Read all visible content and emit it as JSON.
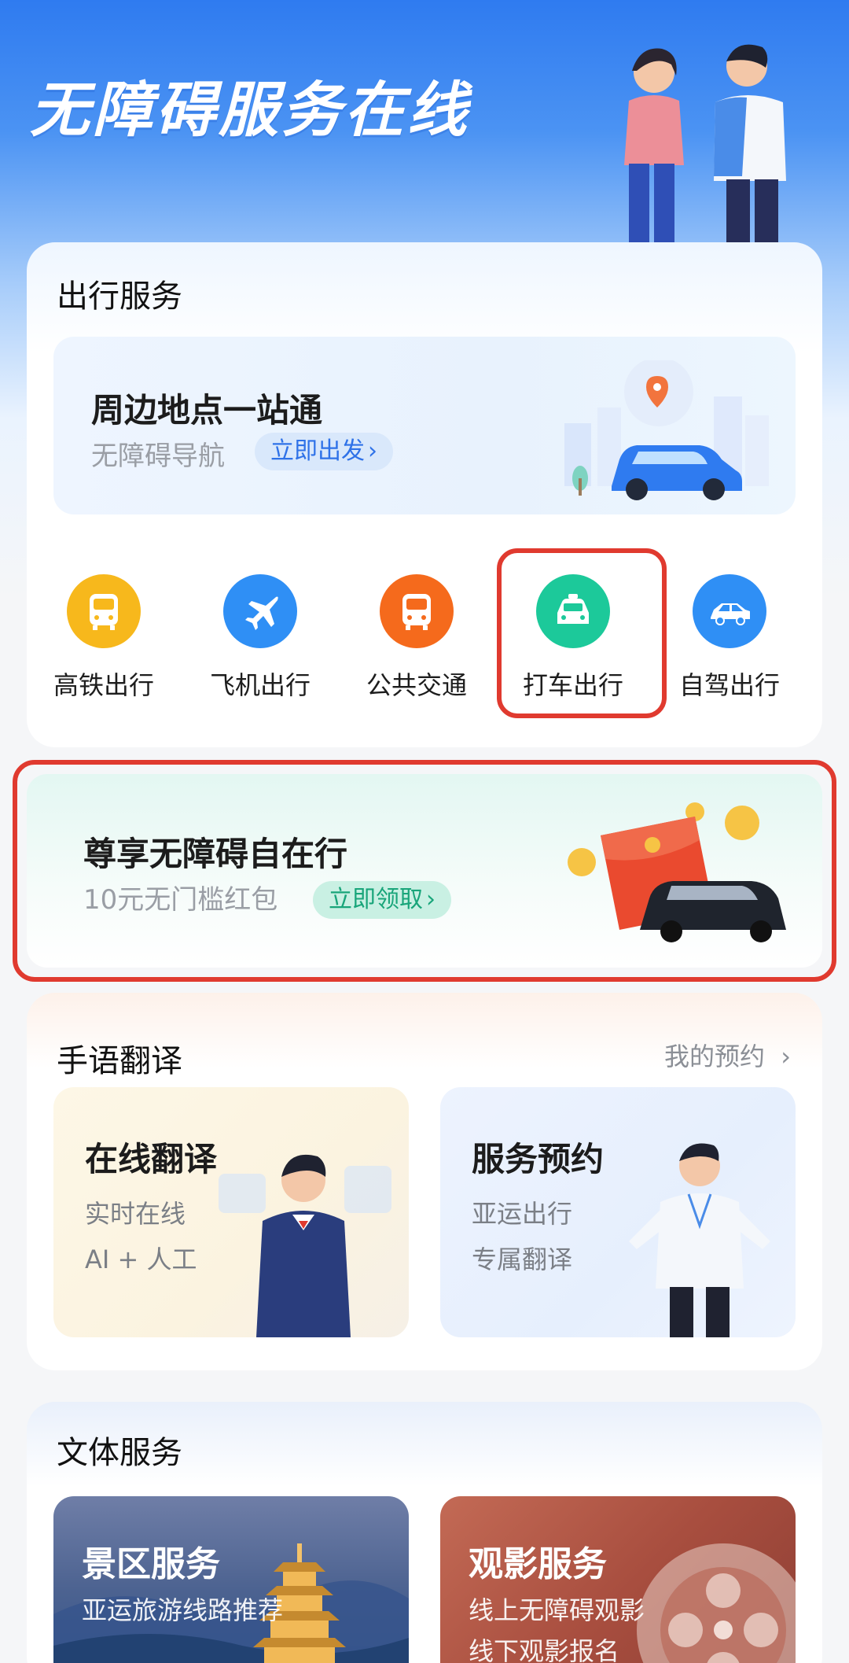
{
  "hero": {
    "title": "无障碍服务在线"
  },
  "travel": {
    "title": "出行服务",
    "banner": {
      "heading": "周边地点一站通",
      "subtitle": "无障碍导航",
      "action": "立即出发"
    },
    "icons": [
      {
        "label": "高铁出行",
        "icon": "bus-icon",
        "color": "#f7b81c"
      },
      {
        "label": "飞机出行",
        "icon": "airplane-icon",
        "color": "#2f8ff5"
      },
      {
        "label": "公共交通",
        "icon": "bus-icon",
        "color": "#f56a1c"
      },
      {
        "label": "打车出行",
        "icon": "taxi-icon",
        "color": "#1cc99a"
      },
      {
        "label": "自驾出行",
        "icon": "car-icon",
        "color": "#2f8ff5"
      }
    ]
  },
  "promo": {
    "heading": "尊享无障碍自在行",
    "subtitle": "10元无门槛红包",
    "action": "立即领取"
  },
  "sign": {
    "title": "手语翻译",
    "more": "我的预约",
    "online": {
      "heading": "在线翻译",
      "line1": "实时在线",
      "line2": "AI + 人工"
    },
    "booking": {
      "heading": "服务预约",
      "line1": "亚运出行",
      "line2": "专属翻译"
    }
  },
  "culture": {
    "title": "文体服务",
    "scenic": {
      "heading": "景区服务",
      "line1": "亚运旅游线路推荐"
    },
    "movie": {
      "heading": "观影服务",
      "line1": "线上无障碍观影",
      "line2": "线下观影报名"
    }
  },
  "colors": {
    "highlight": "#e03a2f",
    "accent_blue": "#2f72e8",
    "accent_green": "#19a57a"
  }
}
